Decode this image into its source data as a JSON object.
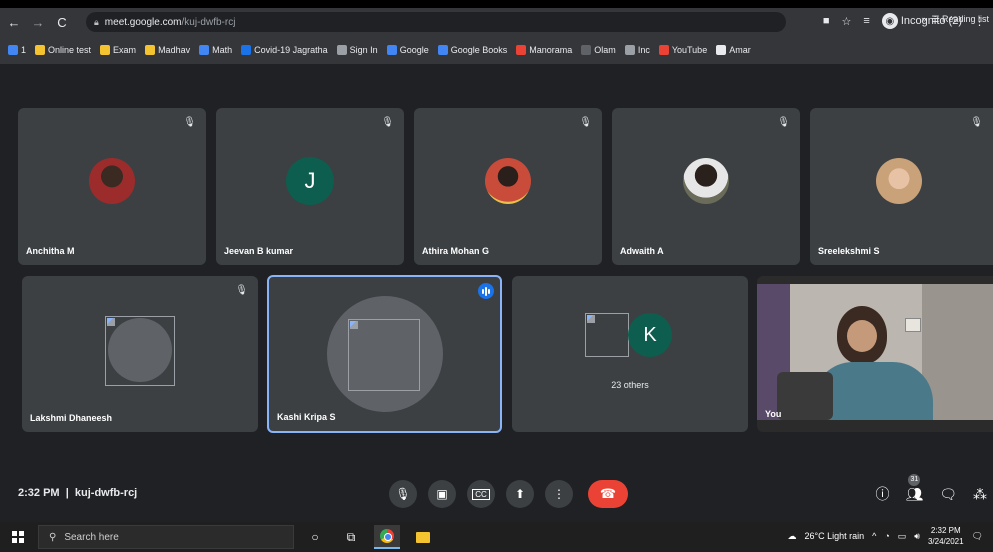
{
  "browser": {
    "url_host": "meet.google.com",
    "url_path": "/kuj-dwfb-rcj",
    "incognito_label": "Incognito (2)",
    "bookmarks": [
      {
        "label": "1",
        "color": "#4285f4"
      },
      {
        "label": "Online test",
        "color": "#f4c430"
      },
      {
        "label": "Exam",
        "color": "#f4c430"
      },
      {
        "label": "Madhav",
        "color": "#f4c430"
      },
      {
        "label": "Math",
        "color": "#4285f4"
      },
      {
        "label": "Covid-19 Jagratha",
        "color": "#1a73e8"
      },
      {
        "label": "Sign In",
        "color": "#9aa0a6"
      },
      {
        "label": "Google",
        "color": "#4285f4"
      },
      {
        "label": "Google Books",
        "color": "#4285f4"
      },
      {
        "label": "Manorama",
        "color": "#ea4335"
      },
      {
        "label": "Olam",
        "color": "#5f6368"
      },
      {
        "label": "Inc",
        "color": "#9aa0a6"
      },
      {
        "label": "YouTube",
        "color": "#ea4335"
      },
      {
        "label": "Amar",
        "color": "#e8eaed"
      }
    ],
    "reading_list": "Reading list"
  },
  "participants_row1": [
    {
      "name": "Anchitha M",
      "kind": "photo",
      "photo_bg": "#9c2b2b"
    },
    {
      "name": "Jeevan B kumar",
      "kind": "letter",
      "letter": "J"
    },
    {
      "name": "Athira Mohan G",
      "kind": "photo",
      "photo_bg": "#c94b3a"
    },
    {
      "name": "Adwaith A",
      "kind": "photo",
      "photo_bg": "#6b6b5a"
    },
    {
      "name": "Sreelekshmi S",
      "kind": "photo",
      "photo_bg": "#c9a27a"
    }
  ],
  "participants_row2": [
    {
      "name": "Lakshmi Dhaneesh"
    },
    {
      "name": "Kashi Kripa S"
    },
    {
      "others": "23 others",
      "letter": "K"
    },
    {
      "name": "You"
    }
  ],
  "bottom_bar": {
    "time": "2:32 PM",
    "separator": "|",
    "meeting_code": "kuj-dwfb-rcj",
    "participant_count": "31"
  },
  "taskbar": {
    "search_placeholder": "Search here",
    "weather": "26°C  Light rain",
    "clock_time": "2:32 PM",
    "clock_date": "3/24/2021"
  }
}
